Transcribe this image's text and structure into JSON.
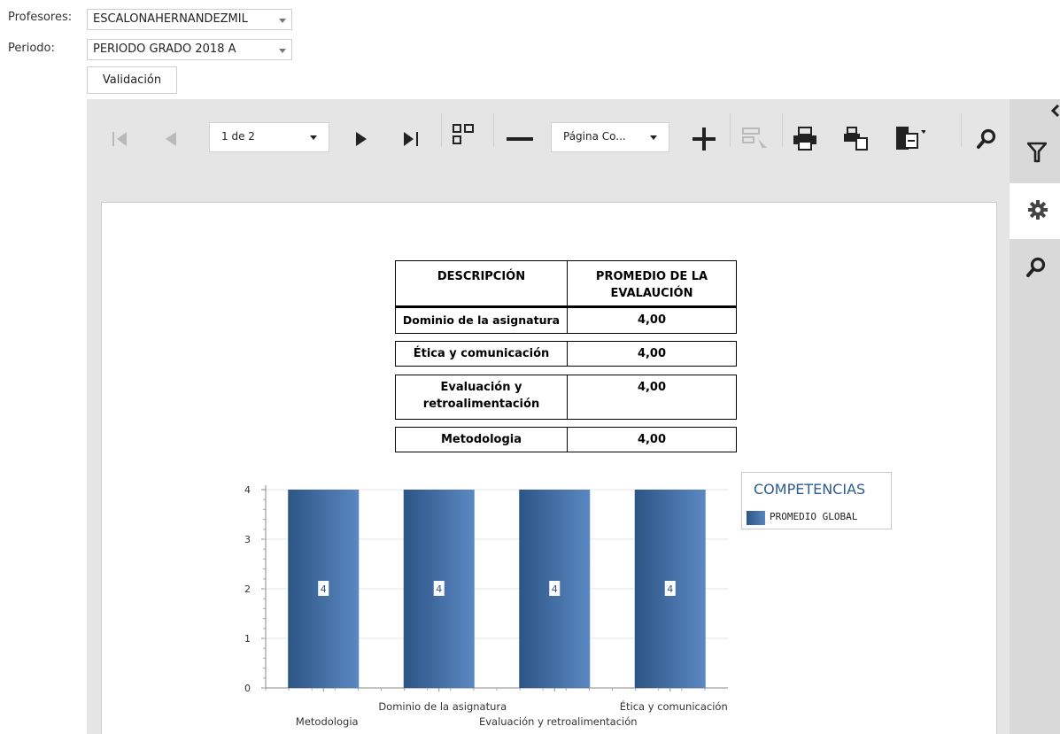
{
  "filters": {
    "profesores_label": "Profesores:",
    "profesores_value": "ESCALONAHERNANDEZMIL",
    "periodo_label": "Periodo:",
    "periodo_value": "PERIODO GRADO 2018 A",
    "validate_label": "Validación"
  },
  "toolbar": {
    "page_selector": "1 de 2",
    "zoom_selector": "Página Co...",
    "icons": [
      "first-page-icon",
      "previous-page-icon",
      "next-page-icon",
      "last-page-icon",
      "multipage-icon",
      "zoom-out-icon",
      "zoom-in-icon",
      "highlight-editing-fields-icon",
      "print-icon",
      "print-page-icon",
      "export-icon",
      "search-icon"
    ]
  },
  "side_panel": {
    "icons": [
      "collapse-arrow-icon",
      "parameters-filter-icon",
      "properties-gear-icon",
      "search-icon"
    ]
  },
  "report": {
    "table": {
      "headers": [
        "DESCRIPCIÓN",
        "PROMEDIO DE LA EVALAUCIÓN"
      ],
      "rows": [
        {
          "descripcion": "Dominio de la asignatura",
          "promedio": "4,00"
        },
        {
          "descripcion": "Ética y comunicación",
          "promedio": "4,00"
        },
        {
          "descripcion": "Evaluación y retroalimentación",
          "promedio": "4,00"
        },
        {
          "descripcion": "Metodologia",
          "promedio": "4,00"
        }
      ]
    }
  },
  "chart_data": {
    "type": "bar",
    "categories": [
      "Metodologia",
      "Dominio de la asignatura",
      "Evaluación y retroalimentación",
      "Ética y comunicación"
    ],
    "series": [
      {
        "name": "PROMEDIO GLOBAL",
        "values": [
          4,
          4,
          4,
          4
        ]
      }
    ],
    "data_labels": [
      "4",
      "4",
      "4",
      "4"
    ],
    "legend_title": "COMPETENCIAS",
    "ylim": [
      0,
      4
    ],
    "yticks": [
      0,
      1,
      2,
      3,
      4
    ],
    "grid": true,
    "legend_position": "right",
    "colors": {
      "bar_dark": "#2c5585",
      "bar_light": "#5b88c3",
      "legend_title": "#2e5c8f"
    }
  }
}
